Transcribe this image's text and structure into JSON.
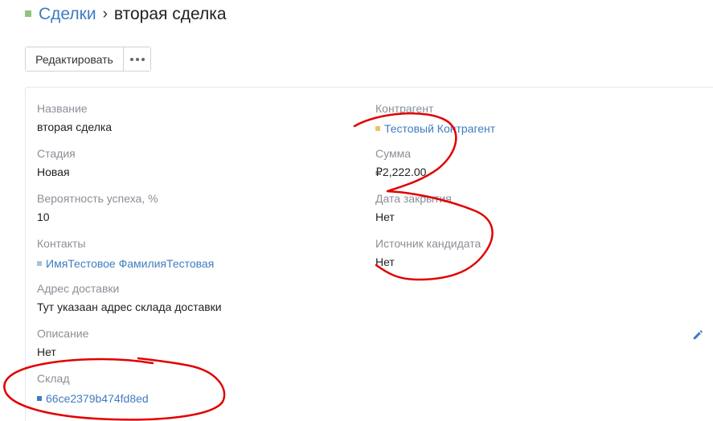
{
  "breadcrumb": {
    "parent": "Сделки",
    "separator": "›",
    "current": "вторая сделка"
  },
  "toolbar": {
    "edit_label": "Редактировать",
    "more_icon": "more-horizontal-icon"
  },
  "fields": {
    "name": {
      "label": "Название",
      "value": "вторая сделка"
    },
    "stage": {
      "label": "Стадия",
      "value": "Новая"
    },
    "probability": {
      "label": "Вероятность успеха, %",
      "value": "10"
    },
    "contacts": {
      "label": "Контакты",
      "value": "ИмяТестовое ФамилияТестовая"
    },
    "delivery_address": {
      "label": "Адрес доставки",
      "value": "Тут указаан адрес склада доставки"
    },
    "description": {
      "label": "Описание",
      "value": "Нет"
    },
    "warehouse": {
      "label": "Склад",
      "value": "66ce2379b474fd8ed"
    },
    "counterparty": {
      "label": "Контрагент",
      "value": "Тестовый Контрагент"
    },
    "amount": {
      "label": "Сумма",
      "value": "₽2,222.00"
    },
    "close_date": {
      "label": "Дата закрытия",
      "value": "Нет"
    },
    "lead_source": {
      "label": "Источник кандидата",
      "value": "Нет"
    }
  },
  "colors": {
    "breadcrumb_square": "#8fc37e",
    "link": "#3f7cc1",
    "contact_marker": "#a9c3de",
    "counterparty_marker": "#e8c56a",
    "warehouse_marker": "#3f7cc1",
    "annotation": "#e00000"
  }
}
